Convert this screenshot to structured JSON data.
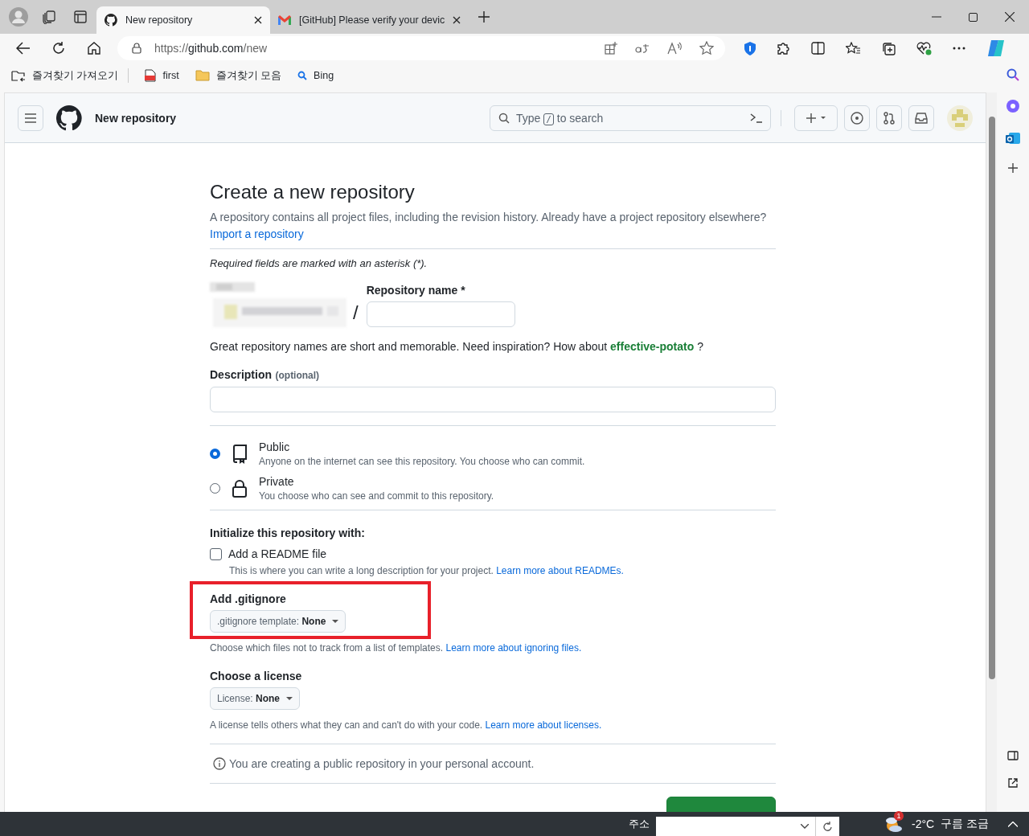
{
  "browser": {
    "tabs": [
      {
        "title": "New repository",
        "kind": "github",
        "selected": true
      },
      {
        "title": "[GitHub] Please verify your devic",
        "kind": "mail",
        "selected": false
      }
    ],
    "url": {
      "scheme": "https://",
      "host": "github.com",
      "path": "/new"
    },
    "bookmarks": [
      {
        "label": "즐겨찾기 가져오기",
        "kind": "import"
      },
      {
        "label": "first",
        "kind": "pdf"
      },
      {
        "label": "즐겨찾기 모음",
        "kind": "folder"
      },
      {
        "label": "Bing",
        "kind": "search"
      }
    ]
  },
  "header": {
    "title": "New repository",
    "search": {
      "prefix": "Type",
      "key": "/",
      "suffix": "to search"
    }
  },
  "form": {
    "heading": "Create a new repository",
    "intro": "A repository contains all project files, including the revision history. Already have a project repository elsewhere?",
    "import_link": "Import a repository",
    "required_note": "Required fields are marked with an asterisk (*).",
    "separator": "/",
    "repo_name_label": "Repository name *",
    "hint": "Great repository names are short and memorable. Need inspiration? How about",
    "suggestion": "effective-potato",
    "hint_end": "?",
    "description_label": "Description",
    "description_optional": "(optional)",
    "visibility": [
      {
        "label": "Public",
        "text": "Anyone on the internet can see this repository. You choose who can commit.",
        "kind": "repo",
        "selected": true
      },
      {
        "label": "Private",
        "text": "You choose who can see and commit to this repository.",
        "kind": "lock",
        "selected": false
      }
    ],
    "init_heading": "Initialize this repository with:",
    "readme": {
      "label": "Add a README file",
      "checked": false,
      "text": "This is where you can write a long description for your project.",
      "link": "Learn more about READMEs."
    },
    "gitignore": {
      "label": "Add .gitignore",
      "prefix": ".gitignore template:",
      "value": "None",
      "text": "Choose which files not to track from a list of templates.",
      "link": "Learn more about ignoring files.",
      "highlighted": true
    },
    "license": {
      "label": "Choose a license",
      "prefix": "License:",
      "value": "None",
      "text": "A license tells others what they can and can't do with your code.",
      "link": "Learn more about licenses."
    },
    "note": "You are creating a public repository in your personal account."
  },
  "taskbar": {
    "address_label": "주소",
    "badge": "1",
    "temperature": "-2°C",
    "weather": "구름 조금"
  }
}
